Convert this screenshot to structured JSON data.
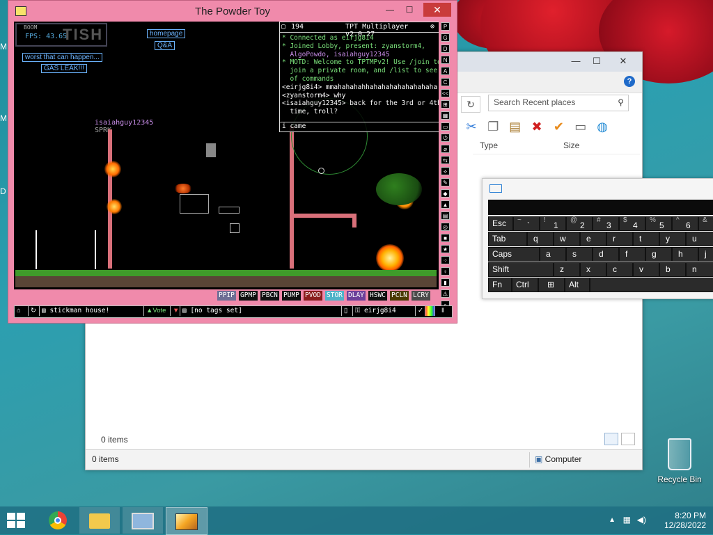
{
  "tpt": {
    "title": "The Powder Toy",
    "fps": "FPS: 43.65",
    "boom_label": "BOOM",
    "logo": "TISH",
    "sign_homepage": "homepage",
    "sign_qa": "Q&A",
    "sign_worst": "worst that can happen...",
    "sign_gasleak": "GAS LEAK!!!",
    "player_tag": "isaiahguy12345",
    "player_sub": "SPRK",
    "chat": {
      "count": "194",
      "version": "TPT Multiplayer v2.0.27",
      "lines": [
        {
          "cls": "cg",
          "text": "* Connected as eirjg8i4"
        },
        {
          "cls": "cg",
          "text": "* Joined Lobby, present: zyanstorm4,"
        },
        {
          "cls": "cm",
          "text": "  AlgoPowdo, isaiahguy12345"
        },
        {
          "cls": "cg",
          "text": "* MOTD: Welcome to TPTMPv2! Use /join to"
        },
        {
          "cls": "cg",
          "text": "  join a private room, and /list to see a list"
        },
        {
          "cls": "cg",
          "text": "  of commands"
        },
        {
          "cls": "cw",
          "text": "<eirjg8i4> mmahahahahhahahahahahahahaha"
        },
        {
          "cls": "cw",
          "text": "<zyanstorm4> why"
        },
        {
          "cls": "cw",
          "text": "<isaiahguy12345> back for the 3rd or 4th"
        },
        {
          "cls": "cw",
          "text": "  time, troll?"
        }
      ],
      "input": "i came"
    },
    "sidebar": [
      "P",
      "G",
      "D",
      "N",
      "A",
      "C",
      "<<",
      "⊞",
      "▦",
      "▭",
      "⏻",
      "⌀",
      "⇆",
      "⟡",
      "✎",
      "◆",
      "▲",
      "▤",
      "◎",
      "■",
      "★",
      "⁘",
      "♀",
      "▮",
      "⚠",
      "⌕"
    ],
    "elements": [
      {
        "label": "PPIP",
        "bg": "#6e6e95",
        "fg": "#ffffff"
      },
      {
        "label": "GPMP",
        "bg": "#101010",
        "fg": "#ffffff"
      },
      {
        "label": "PBCN",
        "bg": "#101010",
        "fg": "#ffffff"
      },
      {
        "label": "PUMP",
        "bg": "#101010",
        "fg": "#ffffff"
      },
      {
        "label": "PVOD",
        "bg": "#8a1d1d",
        "fg": "#ffffff"
      },
      {
        "label": "STOR",
        "bg": "#4fb3c9",
        "fg": "#ffffff"
      },
      {
        "label": "DLAY",
        "bg": "#6c3f9a",
        "fg": "#ffffff"
      },
      {
        "label": "HSWC",
        "bg": "#101010",
        "fg": "#ffffff"
      },
      {
        "label": "PCLN",
        "bg": "#4a3a00",
        "fg": "#ffffff"
      },
      {
        "label": "LCRY",
        "bg": "#4a4a4a",
        "fg": "#ffffff"
      }
    ],
    "bottom": {
      "save_name": "stickman house!",
      "vote": "Vote",
      "tags": "[no tags set]",
      "user": "eirjg8i4"
    }
  },
  "explorer": {
    "search_placeholder": "Search Recent places",
    "col_type": "Type",
    "col_size": "Size",
    "items_count": "0 items",
    "status_items": "0 items",
    "status_location": "Computer"
  },
  "keyboard": {
    "row1": [
      {
        "m": "Esc"
      },
      {
        "s": "~",
        "n": "`"
      },
      {
        "s": "!",
        "n": "1"
      },
      {
        "s": "@",
        "n": "2"
      },
      {
        "s": "#",
        "n": "3"
      },
      {
        "s": "$",
        "n": "4"
      },
      {
        "s": "%",
        "n": "5"
      },
      {
        "s": "^",
        "n": "6"
      },
      {
        "s": "&",
        "n": ""
      }
    ],
    "row2": [
      "Tab",
      "q",
      "w",
      "e",
      "r",
      "t",
      "y",
      "u"
    ],
    "row3": [
      "Caps",
      "a",
      "s",
      "d",
      "f",
      "g",
      "h",
      "j"
    ],
    "row4": [
      "Shift",
      "z",
      "x",
      "c",
      "v",
      "b",
      "n"
    ],
    "row5": [
      "Fn",
      "Ctrl",
      "⊞",
      "Alt"
    ]
  },
  "desktop": {
    "recycle_bin": "Recycle Bin",
    "edge_letters": [
      "M",
      "M",
      "D"
    ]
  },
  "taskbar": {
    "time": "8:20 PM",
    "date": "12/28/2022"
  }
}
